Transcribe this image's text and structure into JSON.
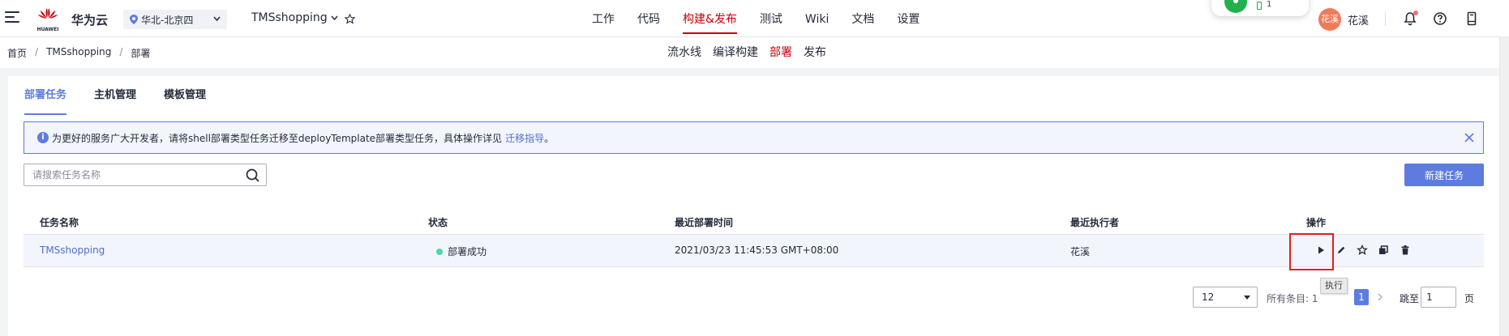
{
  "topbar": {
    "brand_logo_text": "HUAWEI",
    "brand_name": "华为云",
    "region": "华北-北京四",
    "project": "TMSshopping",
    "nav": [
      "工作",
      "代码",
      "构建&发布",
      "测试",
      "Wiki",
      "文档",
      "设置"
    ],
    "active_nav": "构建&发布",
    "widget_count": "1",
    "avatar_text": "花溪",
    "username": "花溪"
  },
  "breadcrumb": [
    "首页",
    "TMSshopping",
    "部署"
  ],
  "subnav": [
    "流水线",
    "编译构建",
    "部署",
    "发布"
  ],
  "tabs": [
    "部署任务",
    "主机管理",
    "模板管理"
  ],
  "notice": {
    "text": "为更好的服务广大开发者，请将shell部署类型任务迁移至deployTemplate部署类型任务，具体操作详见",
    "link": "迁移指导",
    "period": "。"
  },
  "search": {
    "placeholder": "请搜索任务名称"
  },
  "new_task_label": "新建任务",
  "table": {
    "headers": [
      "任务名称",
      "状态",
      "最近部署时间",
      "最近执行者",
      "操作"
    ],
    "rows": [
      {
        "name": "TMSshopping",
        "status": "部署成功",
        "time": "2021/03/23 11:45:53 GMT+08:00",
        "executor": "花溪"
      }
    ]
  },
  "tooltip": "执行",
  "pagination": {
    "page_size": "12",
    "total_label": "所有条目: 1",
    "current_page": "1",
    "jump_label": "跳至",
    "jump_value": "1",
    "page_label": "页"
  },
  "colors": {
    "brand_red": "#c7000b",
    "primary_blue": "#5e7ce0",
    "success_green": "#50d4ab",
    "highlight_red": "#e0201e"
  },
  "icons": [
    "hamburger-icon",
    "location-pin-icon",
    "chevron-down-icon",
    "star-icon",
    "bell-icon",
    "help-icon",
    "mobile-icon",
    "info-icon",
    "close-icon",
    "search-icon",
    "play-icon",
    "edit-icon",
    "copy-icon",
    "delete-icon",
    "chevron-right-icon"
  ]
}
